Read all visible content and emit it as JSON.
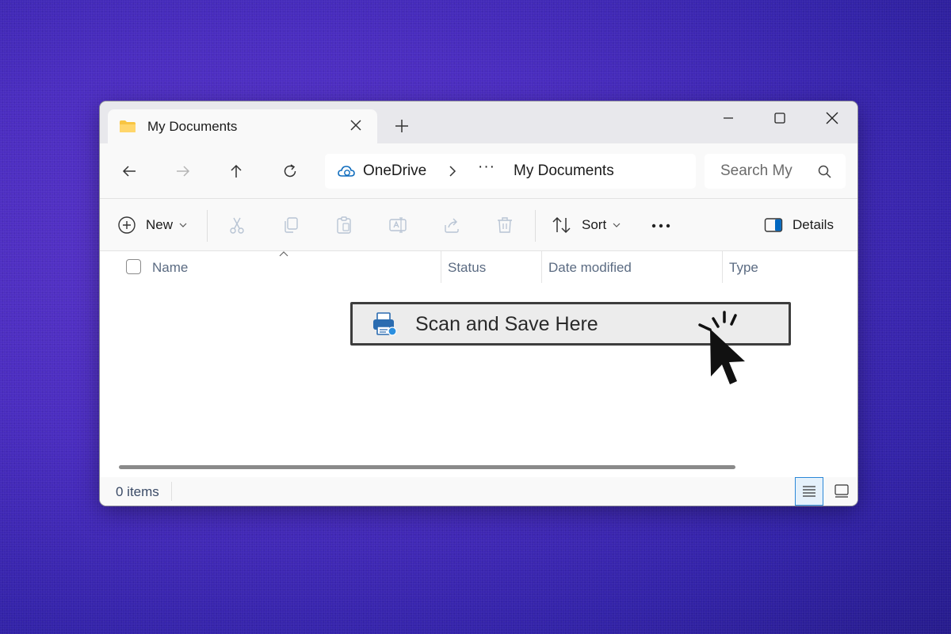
{
  "window": {
    "tab_title": "My Documents",
    "controls": [
      "minimize",
      "maximize",
      "close"
    ]
  },
  "nav": {
    "address": {
      "root": "OneDrive",
      "ellipsis": "···",
      "current": "My Documents"
    },
    "search_placeholder": "Search My"
  },
  "toolbar": {
    "new_label": "New",
    "sort_label": "Sort",
    "more_label": "•••",
    "details_label": "Details"
  },
  "columns": {
    "name": "Name",
    "status": "Status",
    "date_modified": "Date modified",
    "type": "Type"
  },
  "overlay": {
    "scan_label": "Scan and Save Here"
  },
  "status": {
    "item_count": "0 items"
  },
  "colors": {
    "accent": "#0067c0",
    "onedrive_blue": "#0f6cbd",
    "folder_yellow": "#f8c542",
    "background": "#4a2cc0"
  }
}
